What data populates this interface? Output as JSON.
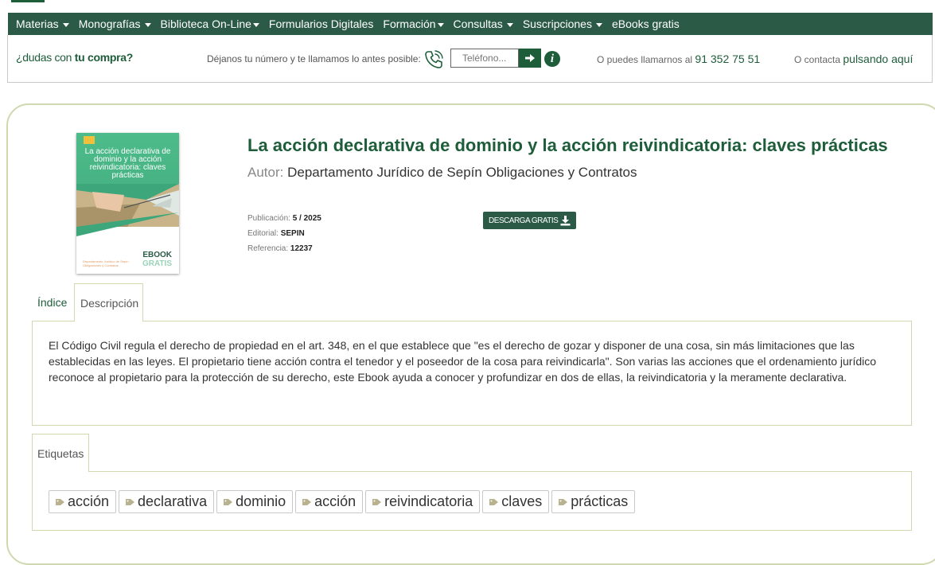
{
  "nav": {
    "items": [
      {
        "label": "Materias",
        "caret": true
      },
      {
        "label": "Monografías",
        "caret": true
      },
      {
        "label": "Biblioteca On-Line",
        "caret": true
      },
      {
        "label": "Formularios Digitales",
        "caret": false
      },
      {
        "label": "Formación",
        "caret": true
      },
      {
        "label": "Consultas",
        "caret": true
      },
      {
        "label": "Suscripciones",
        "caret": true
      },
      {
        "label": "eBooks gratis",
        "caret": false
      }
    ]
  },
  "contact": {
    "dudas_prefix": "¿dudas con ",
    "dudas_bold": "tu compra?",
    "callback_text": "Déjanos tu número y te llamamos lo antes posible:",
    "phone_placeholder": "Teléfono...",
    "call_prefix": "O puedes llamarnos al ",
    "phone_number": "91 352 75 51",
    "contact_prefix": "O contacta ",
    "contact_link": "pulsando aquí"
  },
  "book": {
    "title": "La acción declarativa de dominio y la acción reivindicatoria: claves prácticas",
    "author_label": "Autor: ",
    "author": "Departamento Jurídico de Sepín Obligaciones y Contratos",
    "publication_label": "Publicación: ",
    "publication": "5 / 2025",
    "editorial_label": "Editorial: ",
    "editorial": "SEPIN",
    "reference_label": "Referencia: ",
    "reference": "12237",
    "download_label": "DESCARGA GRATIS",
    "cover": {
      "title": "La acción declarativa de dominio y la acción reivindicatoria: claves prácticas",
      "badge_line1": "EBOOK",
      "badge_line2": "GRATIS",
      "credit_line1": "Departamento Jurídico de Sepín",
      "credit_line2": "Obligaciones y Contratos"
    }
  },
  "tabs": {
    "indice": "Índice",
    "descripcion": "Descripción",
    "etiquetas": "Etiquetas"
  },
  "description": "El Código Civil regula el derecho de propiedad en el art. 348, en el que establece que \"es el derecho de gozar y disponer de una cosa, sin más limitaciones que las establecidas en las leyes. El propietario tiene acción contra el tenedor y el poseedor de la cosa para reivindicarla\". Son varias las acciones que el ordenamiento jurídico reconoce al propietario para la protección de su derecho, este Ebook ayuda a conocer y profundizar en dos de ellas, la reivindicatoria y la meramente declarativa.",
  "tags": [
    "acción",
    "declarativa",
    "dominio",
    "acción",
    "reivindicatoria",
    "claves",
    "prácticas"
  ],
  "colors": {
    "brand_green": "#1e5d3a",
    "nav_bg": "#2b5a46",
    "border_olive": "#cfd9b0"
  },
  "icons": {
    "phone": "phone-ringing-icon",
    "arrow": "arrow-right-icon",
    "info": "info-icon",
    "download": "download-icon",
    "tag": "tag-icon",
    "caret": "caret-down-icon"
  }
}
